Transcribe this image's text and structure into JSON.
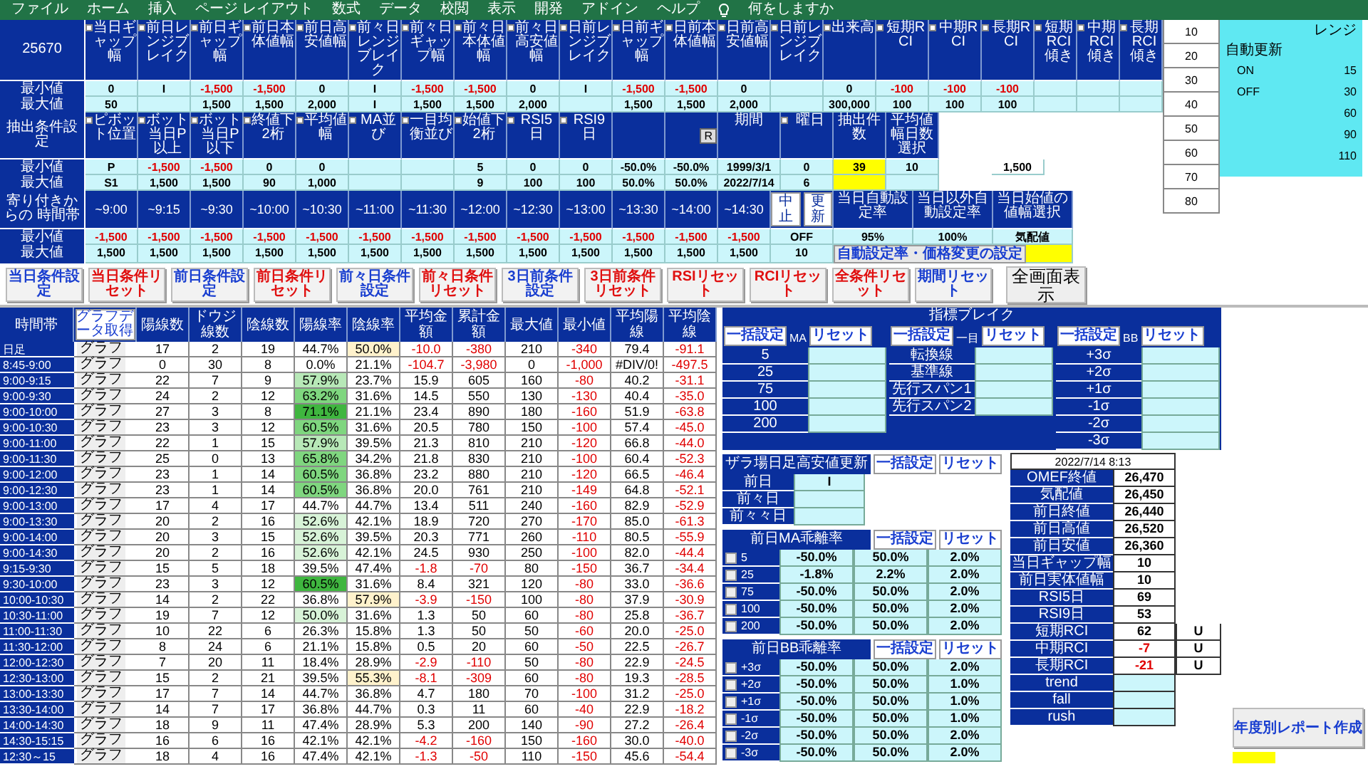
{
  "menu": {
    "items": [
      "ファイル",
      "ホーム",
      "挿入",
      "ページ レイアウト",
      "数式",
      "データ",
      "校閲",
      "表示",
      "開発",
      "アドイン",
      "ヘルプ"
    ],
    "search": "何をしますか"
  },
  "bands": [
    {
      "corner": "25670",
      "headers": [
        {
          "label": "当日ギャップ幅",
          "checked": false
        },
        {
          "label": "前日レンジブレイク",
          "checked": false
        },
        {
          "label": "前日ギャップ幅",
          "checked": false
        },
        {
          "label": "前日本体値幅",
          "checked": false
        },
        {
          "label": "前日高安値幅",
          "checked": false
        },
        {
          "label": "前々日レンジブレイク",
          "checked": false
        },
        {
          "label": "前々日ギャップ幅",
          "checked": false
        },
        {
          "label": "前々日本体値幅",
          "checked": false
        },
        {
          "label": "前々日高安値幅",
          "checked": false
        },
        {
          "label": "日前レンジブレイク",
          "checked": false
        },
        {
          "label": "日前ギャップ幅",
          "checked": false
        },
        {
          "label": "日前本体値幅",
          "checked": false
        },
        {
          "label": "日前高安値幅",
          "checked": false
        },
        {
          "label": "日前レンジブレイク",
          "checked": false
        },
        {
          "label": "出来高",
          "checked": false
        },
        {
          "label": "短期RCI",
          "checked": false
        },
        {
          "label": "中期RCI",
          "checked": false
        },
        {
          "label": "長期RCI",
          "checked": false
        },
        {
          "label": "短期RCI傾き",
          "checked": false
        },
        {
          "label": "中期RCI傾き",
          "checked": false
        },
        {
          "label": "長期RCI傾き",
          "checked": false
        }
      ],
      "rows": [
        {
          "label": "最小値",
          "cells": [
            "0",
            "I",
            {
              "t": "-1,500",
              "negative": true
            },
            {
              "t": "-1,500",
              "negative": true
            },
            "0",
            "I",
            {
              "t": "-1,500",
              "negative": true
            },
            {
              "t": "-1,500",
              "negative": true
            },
            "0",
            "I",
            {
              "t": "-1,500",
              "negative": true
            },
            {
              "t": "-1,500",
              "negative": true
            },
            "0",
            null,
            "0",
            {
              "t": "-100",
              "negative": true
            },
            {
              "t": "-100",
              "negative": true
            },
            {
              "t": "-100",
              "negative": true
            },
            null,
            null,
            null
          ]
        },
        {
          "label": "最大値",
          "cells": [
            "50",
            null,
            "1,500",
            "1,500",
            "2,000",
            "I",
            "1,500",
            "1,500",
            "2,000",
            null,
            "1,500",
            "1,500",
            "2,000",
            null,
            "300,000",
            "100",
            "100",
            "100",
            null,
            null,
            null
          ]
        }
      ]
    },
    {
      "corner": "抽出条件設定",
      "headers": [
        {
          "label": "ピボット位置",
          "checked": false
        },
        {
          "label": "ボット当日P以上",
          "checked": false
        },
        {
          "label": "ボット当日P以下",
          "checked": false
        },
        {
          "label": "終値下2桁",
          "checked": false
        },
        {
          "label": "平均値幅",
          "checked": false
        },
        {
          "label": "MA並び",
          "checked": false
        },
        {
          "label": "一目均衡並び",
          "checked": false
        },
        {
          "label": "始値下2桁",
          "checked": false
        },
        {
          "label": "RSI5日",
          "checked": false
        },
        {
          "label": "RSI9日",
          "checked": false
        },
        {
          "kind": "plain"
        },
        {
          "kind": "tag",
          "label": "R"
        },
        {
          "label": "期間"
        },
        {
          "label": "曜日",
          "checked": false
        },
        {
          "label": "抽出件数"
        },
        {
          "label": "平均値幅日数選択"
        },
        {
          "kind": "blank"
        },
        {
          "kind": "blank"
        }
      ],
      "rows": [
        {
          "label": "最小値",
          "cells": [
            "P",
            {
              "t": "-1,500",
              "negative": true
            },
            {
              "t": "-1,500",
              "negative": true
            },
            "0",
            "0",
            null,
            null,
            "5",
            "0",
            "0",
            "-50.0%",
            "-50.0%",
            "1999/3/1",
            "0",
            {
              "t": "39",
              "color": "#ffff00"
            },
            "10",
            null,
            "1,500"
          ]
        },
        {
          "label": "最大値",
          "cells": [
            "S1",
            "1,500",
            "1,500",
            "90",
            "1,000",
            null,
            null,
            "9",
            "100",
            "100",
            "50.0%",
            "50.0%",
            "2022/7/14",
            "6",
            {
              "color": "#ffff00"
            },
            null,
            null,
            null
          ]
        }
      ]
    }
  ],
  "time_band": {
    "corner": "寄り付きからの 時間帯",
    "times": [
      "~9:00",
      "~9:15",
      "~9:30",
      "~10:00",
      "~10:30",
      "~11:00",
      "~11:30",
      "~12:00",
      "~12:30",
      "~13:00",
      "~13:30",
      "~14:00",
      "~14:30"
    ],
    "buttons": [
      "中止",
      "更新"
    ],
    "headers": [
      "当日自動設定率",
      "当日以外自動設定率",
      "当日始値の値幅選択"
    ],
    "rows": [
      {
        "label": "最小値",
        "cells": [
          {
            "t": "-1,500",
            "negative": true
          },
          {
            "t": "-1,500",
            "negative": true
          },
          {
            "t": "-1,500",
            "negative": true
          },
          {
            "t": "-1,500",
            "negative": true
          },
          {
            "t": "-1,500",
            "negative": true
          },
          {
            "t": "-1,500",
            "negative": true
          },
          {
            "t": "-1,500",
            "negative": true
          },
          {
            "t": "-1,500",
            "negative": true
          },
          {
            "t": "-1,500",
            "negative": true
          },
          {
            "t": "-1,500",
            "negative": true
          },
          {
            "t": "-1,500",
            "negative": true
          },
          {
            "t": "-1,500",
            "negative": true
          },
          {
            "t": "-1,500",
            "negative": true
          }
        ],
        "extra": [
          "OFF",
          "95%",
          "100%",
          "気配値"
        ]
      },
      {
        "label": "最大値",
        "cells": [
          "1,500",
          "1,500",
          "1,500",
          "1,500",
          "1,500",
          "1,500",
          "1,500",
          "1,500",
          "1,500",
          "1,500",
          "1,500",
          "1,500",
          "1,500"
        ],
        "extra": [
          "10",
          {
            "kind": "button",
            "t": "自動設定率・価格変更の設定"
          },
          {
            "kind": "blank",
            "color": "#ffff00"
          }
        ]
      }
    ]
  },
  "action_buttons": [
    {
      "label": "当日条件設定",
      "color": "#1a3fd0"
    },
    {
      "label": "当日条件リセット",
      "color": "#e01010"
    },
    {
      "label": "前日条件設定",
      "color": "#1a3fd0"
    },
    {
      "label": "前日条件リセット",
      "color": "#e01010"
    },
    {
      "label": "前々日条件設定",
      "color": "#1a3fd0"
    },
    {
      "label": "前々日条件リセット",
      "color": "#e01010"
    },
    {
      "label": "3日前条件設定",
      "color": "#1a3fd0"
    },
    {
      "label": "3日前条件リセット",
      "color": "#e01010"
    },
    {
      "label": "RSIリセット",
      "color": "#e01010"
    },
    {
      "label": "RCIリセット",
      "color": "#e01010"
    },
    {
      "label": "全条件リセット",
      "color": "#e01010"
    },
    {
      "label": "期間リセット",
      "color": "#1a3fd0"
    }
  ],
  "fullscreen_button": "全画面表示",
  "levels": [
    "10",
    "20",
    "30",
    "40",
    "50",
    "60",
    "70",
    "80"
  ],
  "range_panel": {
    "title": "レンジ",
    "label": "自動更新",
    "rows": [
      {
        "k": "ON",
        "v": "15"
      },
      {
        "k": "OFF",
        "v": "30"
      },
      {
        "v": "60"
      },
      {
        "v": "90"
      },
      {
        "v": "110"
      }
    ]
  },
  "table": {
    "time_header": "時間帯",
    "data_button": "グラフデータ取得",
    "columns": [
      "陽線数",
      "ドウジ線数",
      "陰線数",
      "陽線率",
      "陰線率",
      "平均金額",
      "累計金額",
      "最大値",
      "最小値",
      "平均陽線",
      "平均陰線"
    ],
    "rows": [
      {
        "time": "日足",
        "graph": "グラフ",
        "cells": [
          "17",
          "2",
          "19",
          "44.7%",
          {
            "t": "50.0%",
            "color": "#fff2cc"
          },
          {
            "t": "-10.0",
            "negative": true
          },
          {
            "t": "-380",
            "negative": true
          },
          "210",
          {
            "t": "-340",
            "negative": true
          },
          "79.4",
          {
            "t": "-91.1",
            "negative": true
          }
        ]
      },
      {
        "time": "8:45-9:00",
        "graph": "グラフ",
        "cells": [
          "0",
          "30",
          "8",
          "0.0%",
          "21.1%",
          {
            "t": "-104.7",
            "negative": true
          },
          {
            "t": "-3,980",
            "negative": true
          },
          "0",
          {
            "t": "-1,000",
            "negative": true
          },
          "#DIV/0!",
          {
            "t": "-497.5",
            "negative": true
          }
        ]
      },
      {
        "time": "9:00-9:15",
        "graph": "グラフ",
        "cells": [
          "22",
          "7",
          "9",
          {
            "t": "57.9%",
            "color": "#b7e8b7"
          },
          "23.7%",
          "15.9",
          "605",
          "160",
          {
            "t": "-80",
            "negative": true
          },
          "40.2",
          {
            "t": "-31.1",
            "negative": true
          }
        ]
      },
      {
        "time": "9:00-9:30",
        "graph": "グラフ",
        "cells": [
          "24",
          "2",
          "12",
          {
            "t": "63.2%",
            "color": "#7fd67f"
          },
          "31.6%",
          "14.5",
          "550",
          "130",
          {
            "t": "-130",
            "negative": true
          },
          "40.4",
          {
            "t": "-35.0",
            "negative": true
          }
        ]
      },
      {
        "time": "9:00-10:00",
        "graph": "グラフ",
        "cells": [
          "27",
          "3",
          "8",
          {
            "t": "71.1%",
            "color": "#3fb63f"
          },
          "21.1%",
          "23.4",
          "890",
          "180",
          {
            "t": "-160",
            "negative": true
          },
          "51.9",
          {
            "t": "-63.8",
            "negative": true
          }
        ]
      },
      {
        "time": "9:00-10:30",
        "graph": "グラフ",
        "cells": [
          "23",
          "3",
          "12",
          {
            "t": "60.5%",
            "color": "#7fd67f"
          },
          "31.6%",
          "20.5",
          "780",
          "150",
          {
            "t": "-100",
            "negative": true
          },
          "57.4",
          {
            "t": "-45.0",
            "negative": true
          }
        ]
      },
      {
        "time": "9:00-11:00",
        "graph": "グラフ",
        "cells": [
          "22",
          "1",
          "15",
          {
            "t": "57.9%",
            "color": "#b7e8b7"
          },
          "39.5%",
          "21.3",
          "810",
          "210",
          {
            "t": "-120",
            "negative": true
          },
          "66.8",
          {
            "t": "-44.0",
            "negative": true
          }
        ]
      },
      {
        "time": "9:00-11:30",
        "graph": "グラフ",
        "cells": [
          "25",
          "0",
          "13",
          {
            "t": "65.8%",
            "color": "#7fd67f"
          },
          "34.2%",
          "21.8",
          "830",
          "210",
          {
            "t": "-100",
            "negative": true
          },
          "60.4",
          {
            "t": "-52.3",
            "negative": true
          }
        ]
      },
      {
        "time": "9:00-12:00",
        "graph": "グラフ",
        "cells": [
          "23",
          "1",
          "14",
          {
            "t": "60.5%",
            "color": "#7fd67f"
          },
          "36.8%",
          "23.2",
          "880",
          "210",
          {
            "t": "-120",
            "negative": true
          },
          "66.5",
          {
            "t": "-46.4",
            "negative": true
          }
        ]
      },
      {
        "time": "9:00-12:30",
        "graph": "グラフ",
        "cells": [
          "23",
          "1",
          "14",
          {
            "t": "60.5%",
            "color": "#7fd67f"
          },
          "36.8%",
          "20.0",
          "761",
          "210",
          {
            "t": "-149",
            "negative": true
          },
          "64.8",
          {
            "t": "-52.1",
            "negative": true
          }
        ]
      },
      {
        "time": "9:00-13:00",
        "graph": "グラフ",
        "cells": [
          "17",
          "4",
          "17",
          "44.7%",
          "44.7%",
          "13.4",
          "511",
          "240",
          {
            "t": "-160",
            "negative": true
          },
          "82.9",
          {
            "t": "-52.9",
            "negative": true
          }
        ]
      },
      {
        "time": "9:00-13:30",
        "graph": "グラフ",
        "cells": [
          "20",
          "2",
          "16",
          {
            "t": "52.6%",
            "color": "#d8f3d8"
          },
          "42.1%",
          "18.9",
          "720",
          "270",
          {
            "t": "-170",
            "negative": true
          },
          "85.0",
          {
            "t": "-61.3",
            "negative": true
          }
        ]
      },
      {
        "time": "9:00-14:00",
        "graph": "グラフ",
        "cells": [
          "20",
          "3",
          "15",
          {
            "t": "52.6%",
            "color": "#d8f3d8"
          },
          "39.5%",
          "20.3",
          "771",
          "260",
          {
            "t": "-110",
            "negative": true
          },
          "80.5",
          {
            "t": "-55.9",
            "negative": true
          }
        ]
      },
      {
        "time": "9:00-14:30",
        "graph": "グラフ",
        "cells": [
          "20",
          "2",
          "16",
          {
            "t": "52.6%",
            "color": "#d8f3d8"
          },
          "42.1%",
          "24.5",
          "930",
          "250",
          {
            "t": "-100",
            "negative": true
          },
          "82.0",
          {
            "t": "-44.4",
            "negative": true
          }
        ]
      },
      {
        "time": "9:15-9:30",
        "graph": "グラフ",
        "cells": [
          "15",
          "5",
          "18",
          "39.5%",
          "47.4%",
          {
            "t": "-1.8",
            "negative": true
          },
          {
            "t": "-70",
            "negative": true
          },
          "80",
          {
            "t": "-150",
            "negative": true
          },
          "36.7",
          {
            "t": "-34.4",
            "negative": true
          }
        ]
      },
      {
        "time": "9:30-10:00",
        "graph": "グラフ",
        "cells": [
          "23",
          "3",
          "12",
          {
            "t": "60.5%",
            "color": "#3fb63f"
          },
          "31.6%",
          "8.4",
          "321",
          "120",
          {
            "t": "-80",
            "negative": true
          },
          "33.0",
          {
            "t": "-36.6",
            "negative": true
          }
        ]
      },
      {
        "time": "10:00-10:30",
        "graph": "グラフ",
        "cells": [
          "14",
          "2",
          "22",
          "36.8%",
          {
            "t": "57.9%",
            "color": "#fff2cc"
          },
          {
            "t": "-3.9",
            "negative": true
          },
          {
            "t": "-150",
            "negative": true
          },
          "100",
          {
            "t": "-80",
            "negative": true
          },
          "37.9",
          {
            "t": "-30.9",
            "negative": true
          }
        ]
      },
      {
        "time": "10:30-11:00",
        "graph": "グラフ",
        "cells": [
          "19",
          "7",
          "12",
          {
            "t": "50.0%",
            "color": "#d8f3d8"
          },
          "31.6%",
          "1.3",
          "50",
          "60",
          {
            "t": "-80",
            "negative": true
          },
          "25.8",
          {
            "t": "-36.7",
            "negative": true
          }
        ]
      },
      {
        "time": "11:00-11:30",
        "graph": "グラフ",
        "cells": [
          "10",
          "22",
          "6",
          "26.3%",
          "15.8%",
          "1.3",
          "50",
          "50",
          {
            "t": "-60",
            "negative": true
          },
          "20.0",
          {
            "t": "-25.0",
            "negative": true
          }
        ]
      },
      {
        "time": "11:30-12:00",
        "graph": "グラフ",
        "cells": [
          "8",
          "24",
          "6",
          "21.1%",
          "15.8%",
          "0.5",
          "20",
          "60",
          {
            "t": "-50",
            "negative": true
          },
          "22.5",
          {
            "t": "-26.7",
            "negative": true
          }
        ]
      },
      {
        "time": "12:00-12:30",
        "graph": "グラフ",
        "cells": [
          "7",
          "20",
          "11",
          "18.4%",
          "28.9%",
          {
            "t": "-2.9",
            "negative": true
          },
          {
            "t": "-110",
            "negative": true
          },
          "50",
          {
            "t": "-80",
            "negative": true
          },
          "22.9",
          {
            "t": "-24.5",
            "negative": true
          }
        ]
      },
      {
        "time": "12:30-13:00",
        "graph": "グラフ",
        "cells": [
          "15",
          "2",
          "21",
          "39.5%",
          {
            "t": "55.3%",
            "color": "#fff2cc"
          },
          {
            "t": "-8.1",
            "negative": true
          },
          {
            "t": "-309",
            "negative": true
          },
          "60",
          {
            "t": "-80",
            "negative": true
          },
          "19.3",
          {
            "t": "-28.5",
            "negative": true
          }
        ]
      },
      {
        "time": "13:00-13:30",
        "graph": "グラフ",
        "cells": [
          "17",
          "7",
          "14",
          "44.7%",
          "36.8%",
          "4.7",
          "180",
          "70",
          {
            "t": "-100",
            "negative": true
          },
          "31.2",
          {
            "t": "-25.0",
            "negative": true
          }
        ]
      },
      {
        "time": "13:30-14:00",
        "graph": "グラフ",
        "cells": [
          "14",
          "7",
          "17",
          "36.8%",
          "44.7%",
          "0.3",
          "11",
          "60",
          {
            "t": "-40",
            "negative": true
          },
          "22.9",
          {
            "t": "-18.2",
            "negative": true
          }
        ]
      },
      {
        "time": "14:00-14:30",
        "graph": "グラフ",
        "cells": [
          "18",
          "9",
          "11",
          "47.4%",
          "28.9%",
          "5.3",
          "200",
          "140",
          {
            "t": "-90",
            "negative": true
          },
          "27.2",
          {
            "t": "-26.4",
            "negative": true
          }
        ]
      },
      {
        "time": "14:30-15:15",
        "graph": "グラフ",
        "cells": [
          "16",
          "6",
          "16",
          "42.1%",
          "42.1%",
          {
            "t": "-4.2",
            "negative": true
          },
          {
            "t": "-160",
            "negative": true
          },
          "150",
          {
            "t": "-160",
            "negative": true
          },
          "30.0",
          {
            "t": "-40.0",
            "negative": true
          }
        ]
      },
      {
        "time": "12:30～15",
        "graph": "グラフ",
        "cells": [
          "18",
          "4",
          "16",
          "47.4%",
          "42.1%",
          {
            "t": "-1.3",
            "negative": true
          },
          {
            "t": "-50",
            "negative": true
          },
          "110",
          {
            "t": "-150",
            "negative": true
          },
          "45.6",
          {
            "t": "-54.4",
            "negative": true
          }
        ]
      }
    ]
  },
  "indicator_break": {
    "title": "指標ブレイク",
    "groups": [
      {
        "set": "一括設定",
        "label": "MA",
        "reset": "リセット",
        "rows": [
          "5",
          "25",
          "75",
          "100",
          "200"
        ]
      },
      {
        "set": "一括設定",
        "label": "一目",
        "reset": "リセット",
        "rows": [
          "転換線",
          "基準線",
          "先行スパン1",
          "先行スパン2"
        ]
      },
      {
        "set": "一括設定",
        "label": "BB",
        "reset": "リセット",
        "rows": [
          "+3σ",
          "+2σ",
          "+1σ",
          "-1σ",
          "-2σ",
          "-3σ"
        ]
      }
    ]
  },
  "zaraba": {
    "title": "ザラ場日足高安値更新",
    "set": "一括設定",
    "reset": "リセット",
    "rows": [
      {
        "k": "前日",
        "v": "I"
      },
      {
        "k": "前々日"
      },
      {
        "k": "前々々日"
      }
    ]
  },
  "ma_deviation": {
    "title": "前日MA乖離率",
    "set": "一括設定",
    "reset": "リセット",
    "rows": [
      {
        "checked": false,
        "k": "5",
        "v": [
          "-50.0%",
          "50.0%",
          "2.0%"
        ]
      },
      {
        "checked": false,
        "k": "25",
        "v": [
          "-1.8%",
          "2.2%",
          "2.0%"
        ]
      },
      {
        "checked": false,
        "k": "75",
        "v": [
          "-50.0%",
          "50.0%",
          "2.0%"
        ]
      },
      {
        "checked": false,
        "k": "100",
        "v": [
          "-50.0%",
          "50.0%",
          "2.0%"
        ]
      },
      {
        "checked": false,
        "k": "200",
        "v": [
          "-50.0%",
          "50.0%",
          "2.0%"
        ]
      }
    ]
  },
  "bb_deviation": {
    "title": "前日BB乖離率",
    "set": "一括設定",
    "reset": "リセット",
    "rows": [
      {
        "checked": false,
        "k": "+3σ",
        "v": [
          "-50.0%",
          "50.0%",
          "2.0%"
        ]
      },
      {
        "checked": false,
        "k": "+2σ",
        "v": [
          "-50.0%",
          "50.0%",
          "1.0%"
        ]
      },
      {
        "checked": false,
        "k": "+1σ",
        "v": [
          "-50.0%",
          "50.0%",
          "1.0%"
        ]
      },
      {
        "checked": false,
        "k": "-1σ",
        "v": [
          "-50.0%",
          "50.0%",
          "1.0%"
        ]
      },
      {
        "checked": false,
        "k": "-2σ",
        "v": [
          "-50.0%",
          "50.0%",
          "2.0%"
        ]
      },
      {
        "checked": false,
        "k": "-3σ",
        "v": [
          "-50.0%",
          "50.0%",
          "2.0%"
        ]
      }
    ]
  },
  "market_info": {
    "timestamp": "2022/7/14 8:13",
    "rows": [
      {
        "k": "OMEF終値",
        "v": "26,470"
      },
      {
        "k": "気配値",
        "v": "26,450"
      },
      {
        "k": "前日終値",
        "v": "26,440"
      },
      {
        "k": "前日高値",
        "v": "26,520"
      },
      {
        "k": "前日安値",
        "v": "26,360"
      },
      {
        "k": "当日ギャップ幅",
        "v": "10"
      },
      {
        "k": "前日実体値幅",
        "v": "10"
      },
      {
        "k": "RSI5日",
        "v": "69"
      },
      {
        "k": "RSI9日",
        "v": "53"
      },
      {
        "k": "短期RCI",
        "v": "62",
        "dir": "U"
      },
      {
        "k": "中期RCI",
        "v": {
          "t": "-7",
          "negative": true
        },
        "dir": "U"
      },
      {
        "k": "長期RCI",
        "v": {
          "t": "-21",
          "negative": true
        },
        "dir": "U"
      },
      {
        "k": "trend"
      },
      {
        "k": "fall"
      },
      {
        "k": "rush"
      }
    ]
  },
  "report": {
    "label": "年度別レポート作成",
    "color": "#ffff00"
  }
}
